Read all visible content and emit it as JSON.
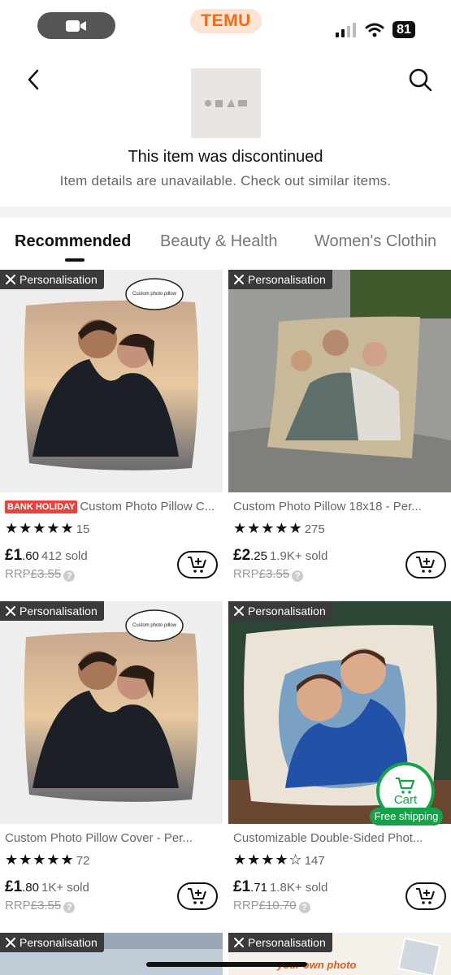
{
  "status": {
    "brand": "TEMU",
    "battery": "81"
  },
  "discontinued": {
    "title": "This item was discontinued",
    "subtitle": "Item details are unavailable. Check out similar items."
  },
  "tabs": [
    {
      "label": "Recommended",
      "active": true
    },
    {
      "label": "Beauty & Health",
      "active": false
    },
    {
      "label": "Women's Clothin",
      "active": false
    }
  ],
  "badge_label": "Personalisation",
  "products": [
    {
      "holiday_tag": "BANK HOLIDAY",
      "title": "Custom Photo Pillow C...",
      "rating": "★★★★★",
      "reviews": "15",
      "price": "£1.60",
      "price_whole": "£1",
      "price_frac": ".60",
      "sold": "412 sold",
      "rrp_label": "RRP",
      "rrp": "£3.55",
      "image_note": "Custom photo pillow"
    },
    {
      "holiday_tag": "",
      "title": "Custom Photo Pillow 18x18 - Per...",
      "rating": "★★★★★",
      "reviews": "275",
      "price": "£2.25",
      "price_whole": "£2",
      "price_frac": ".25",
      "sold": "1.9K+ sold",
      "rrp_label": "RRP",
      "rrp": "£3.55",
      "image_note": ""
    },
    {
      "holiday_tag": "",
      "title": "Custom Photo Pillow Cover - Per...",
      "rating": "★★★★★",
      "reviews": "72",
      "price": "£1.80",
      "price_whole": "£1",
      "price_frac": ".80",
      "sold": "1K+ sold",
      "rrp_label": "RRP",
      "rrp": "£3.55",
      "image_note": "Custom photo pillow"
    },
    {
      "holiday_tag": "",
      "title": "Customizable Double-Sided Phot...",
      "rating": "★★★★☆",
      "reviews": "147",
      "price": "£1.71",
      "price_whole": "£1",
      "price_frac": ".71",
      "sold": "1.8K+ sold",
      "rrp_label": "RRP",
      "rrp": "£10.70",
      "image_note": ""
    }
  ],
  "floating_cart": {
    "label": "Cart",
    "free_shipping": "Free shipping"
  },
  "row3_image_text": "your own photo",
  "colors": {
    "brand_orange": "#f26b1d",
    "green": "#15a34a",
    "holiday_red": "#e6443a"
  }
}
